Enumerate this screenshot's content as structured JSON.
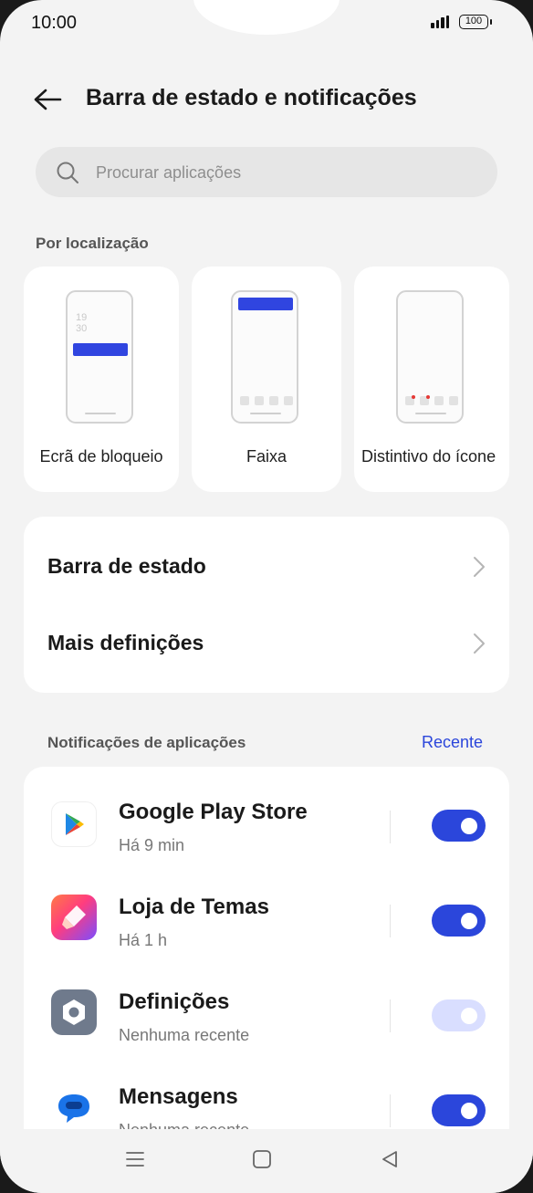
{
  "status_bar": {
    "time": "10:00",
    "battery": "100"
  },
  "header": {
    "title": "Barra de estado e notificações"
  },
  "search": {
    "placeholder": "Procurar aplicações"
  },
  "location_section": {
    "label": "Por localização",
    "cards": [
      {
        "label": "Ecrã de bloqueio",
        "clock_hour": "19",
        "clock_min": "30"
      },
      {
        "label": "Faixa"
      },
      {
        "label": "Distintivo do ícone"
      }
    ]
  },
  "settings_group": {
    "items": [
      {
        "label": "Barra de estado"
      },
      {
        "label": "Mais definições"
      }
    ]
  },
  "app_notifications": {
    "label": "Notificações de aplicações",
    "sort_label": "Recente",
    "apps": [
      {
        "name": "Google Play Store",
        "subtitle": "Há 9 min",
        "icon": "google-play-icon",
        "enabled": true
      },
      {
        "name": "Loja de Temas",
        "subtitle": "Há 1 h",
        "icon": "theme-store-icon",
        "enabled": true
      },
      {
        "name": "Definições",
        "subtitle": "Nenhuma recente",
        "icon": "settings-gear-icon",
        "enabled": true,
        "locked": true
      },
      {
        "name": "Mensagens",
        "subtitle": "Nenhuma recente",
        "icon": "messages-icon",
        "enabled": true
      }
    ]
  },
  "colors": {
    "accent": "#2b46db",
    "background": "#f3f3f3",
    "card": "#ffffff"
  },
  "nav": {
    "icons": [
      "menu-icon",
      "home-icon",
      "back-triangle-icon"
    ]
  }
}
